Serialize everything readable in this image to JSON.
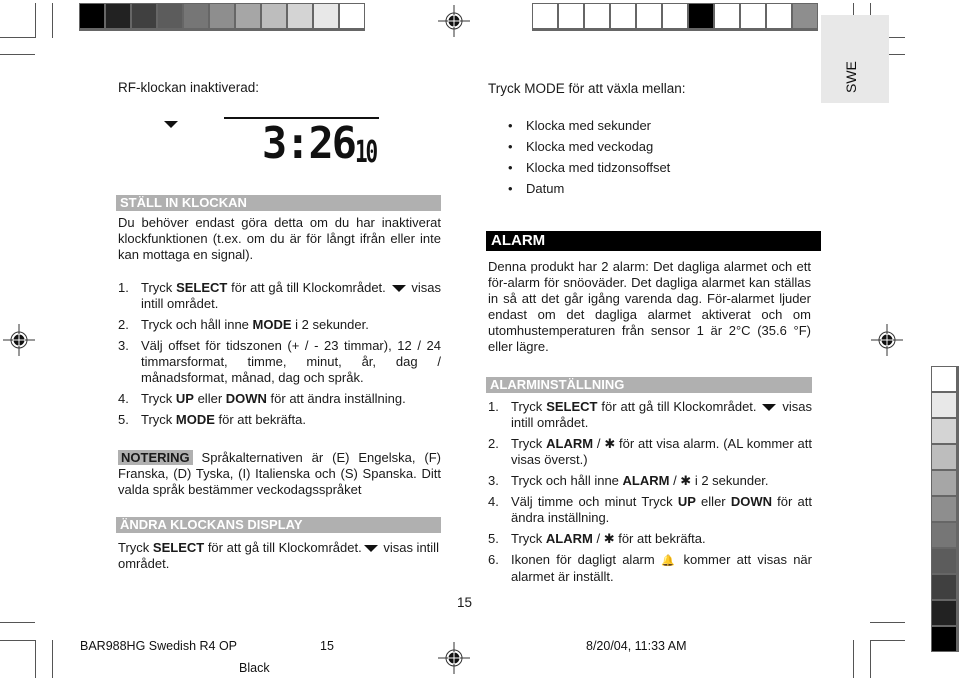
{
  "print_marks": {
    "color_bar_left": [
      "#000000",
      "#222222",
      "#404040",
      "#5c5c5c",
      "#767676",
      "#8e8e8e",
      "#a6a6a6",
      "#bdbdbd",
      "#d4d4d4",
      "#e8e8e8",
      "#ffffff"
    ],
    "color_bar_top_right": [
      "#ffffff",
      "#ffffff",
      "#ffffff",
      "#ffffff",
      "#ffffff",
      "#ffffff",
      "#000000",
      "#ffffff",
      "#ffffff",
      "#ffffff",
      "#8e8e8e"
    ],
    "color_bar_right": [
      "#ffffff",
      "#e8e8e8",
      "#d4d4d4",
      "#bdbdbd",
      "#a6a6a6",
      "#8e8e8e",
      "#767676",
      "#5c5c5c",
      "#404040",
      "#222222",
      "#000000"
    ]
  },
  "language_tab": "SWE",
  "left": {
    "rf_label": "RF-klockan inaktiverad:",
    "lcd": {
      "time": "3:26",
      "seconds": "10"
    },
    "set_clock": {
      "title": "STÄLL IN KLOCKAN",
      "intro": "Du behöver endast göra detta om du har inaktiverat klockfunktionen (t.ex. om du är för långt ifrån eller inte kan mottaga en signal).",
      "steps": [
        {
          "num": "1.",
          "pre": "Tryck ",
          "bold": "SELECT",
          "post": " för att gå till Klockområdet.",
          "icon": "triangle-down",
          "tail": " visas intill området."
        },
        {
          "num": "2.",
          "pre": "Tryck och håll inne ",
          "bold": "MODE",
          "post": " i 2 sekunder."
        },
        {
          "num": "3.",
          "text": "Välj offset för tidszonen (+ / - 23 timmar), 12 / 24 timmarsformat, timme, minut, år, dag / månadsformat, månad, dag och språk."
        },
        {
          "num": "4.",
          "pre": "Tryck ",
          "bold": "UP",
          "mid": " eller ",
          "bold2": "DOWN",
          "post": " för att ändra inställning."
        },
        {
          "num": "5.",
          "pre": "Tryck ",
          "bold": "MODE",
          "post": " för att bekräfta."
        }
      ]
    },
    "note": {
      "badge": "NOTERING",
      "text": " Språkalternativen är (E) Engelska, (F) Franska, (D) Tyska, (I) Italienska och (S) Spanska. Ditt valda språk bestämmer veckodagsspråket"
    },
    "change_display": {
      "title": "ÄNDRA KLOCKANS DISPLAY",
      "pre": "Tryck ",
      "bold": "SELECT",
      "post": " för att gå till Klockområdet.",
      "tail": " visas intill området."
    }
  },
  "right": {
    "mode_label": "Tryck MODE för att växla mellan:",
    "modes": [
      "Klocka med sekunder",
      "Klocka med veckodag",
      "Klocka med tidzonsoffset",
      "Datum"
    ],
    "alarm": {
      "title": "ALARM",
      "text": "Denna produkt har 2 alarm: Det dagliga alarmet och ett för-alarm för snöoväder. Det dagliga alarmet kan ställas in så att det går igång varenda dag. För-alarmet ljuder endast om det dagliga alarmet aktiverat och om utomhustemperaturen från sensor 1 är 2°C (35.6 °F) eller lägre."
    },
    "alarm_setting": {
      "title": "ALARMINSTÄLLNING",
      "steps": [
        {
          "num": "1.",
          "pre": "Tryck ",
          "bold": "SELECT",
          "post": " för att gå till Klockområdet.",
          "tail": " visas intill området."
        },
        {
          "num": "2.",
          "pre": "Tryck ",
          "bold": "ALARM",
          "post": " / ",
          "sym": "✱",
          "tail": " för att visa alarm. (AL kommer att visas överst.)"
        },
        {
          "num": "3.",
          "pre": "Tryck och håll inne ",
          "bold": "ALARM",
          "post": " / ",
          "sym": "✱",
          "tail": " i 2 sekunder."
        },
        {
          "num": "4.",
          "pre": "Välj timme och minut Tryck ",
          "bold": "UP",
          "mid": " eller ",
          "bold2": "DOWN",
          "post": " för att ändra inställning."
        },
        {
          "num": "5.",
          "pre": "Tryck ",
          "bold": "ALARM",
          "post": " / ",
          "sym": "✱",
          "tail": " för att bekräfta."
        },
        {
          "num": "6.",
          "pre": "Ikonen för dagligt alarm ",
          "sym": "🔔",
          "post": " kommer att visas när alarmet är inställt."
        }
      ]
    }
  },
  "page_number": "15",
  "footer": {
    "job": "BAR988HG Swedish R4 OP",
    "page": "15",
    "datetime": "8/20/04, 11:33 AM",
    "plate": "Black"
  }
}
